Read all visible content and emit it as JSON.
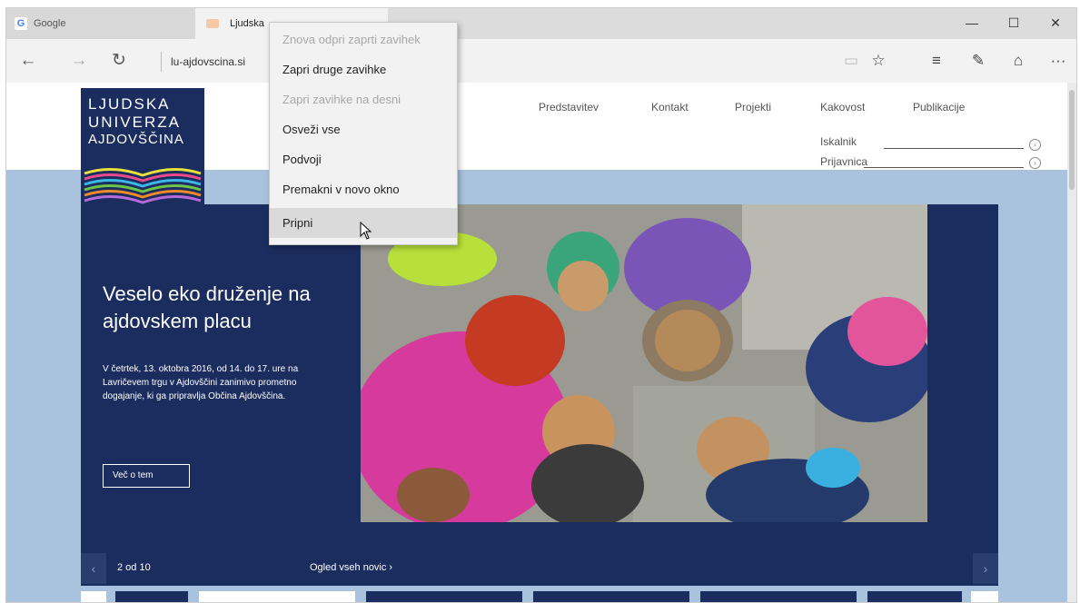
{
  "browser": {
    "tabs": [
      {
        "label": "Google",
        "favicon": "G"
      },
      {
        "label": "Ljudska"
      }
    ],
    "window_controls": {
      "minimize": "—",
      "maximize": "☐",
      "close": "✕"
    },
    "address": "lu-ajdovscina.si",
    "icons": {
      "back": "←",
      "forward": "→",
      "refresh": "↻",
      "reading_view": "▭",
      "favorite": "☆",
      "hub": "≡",
      "notes": "✎",
      "share": "⌂",
      "more": "···"
    }
  },
  "context_menu": {
    "items": [
      {
        "label": "Znova odpri zaprti zavihek",
        "enabled": false
      },
      {
        "label": "Zapri druge zavihke",
        "enabled": true
      },
      {
        "label": "Zapri zavihke na desni",
        "enabled": false
      },
      {
        "label": "Osveži vse",
        "enabled": true
      },
      {
        "label": "Podvoji",
        "enabled": true
      },
      {
        "label": "Premakni v novo okno",
        "enabled": true
      },
      {
        "label": "Pripni",
        "enabled": true,
        "hovered": true
      }
    ]
  },
  "site": {
    "logo": [
      "LJUDSKA",
      "UNIVERZA",
      "AJDOVŠČINA"
    ],
    "nav": [
      "Predstavitev",
      "Kontakt",
      "Projekti",
      "Kakovost",
      "Publikacije"
    ],
    "search_label": "Iskalnik",
    "login_label": "Prijavnica",
    "hero": {
      "title": "Veselo eko druženje na ajdovskem placu",
      "text": "V četrtek, 13. oktobra 2016, od 14. do 17. ure na Lavričevem trgu v Ajdovščini zanimivo prometno dogajanje, ki ga pripravlja Občina Ajdovščina.",
      "button": "Več o tem",
      "pager": "2 od 10",
      "all_news": "Ogled vseh novic ›",
      "prev": "‹",
      "next": "›"
    }
  },
  "colors": {
    "brand_navy": "#1b2d5e",
    "page_background": "#a9c3df",
    "menu_background": "#f2f2f2",
    "menu_hover": "#dadada"
  }
}
